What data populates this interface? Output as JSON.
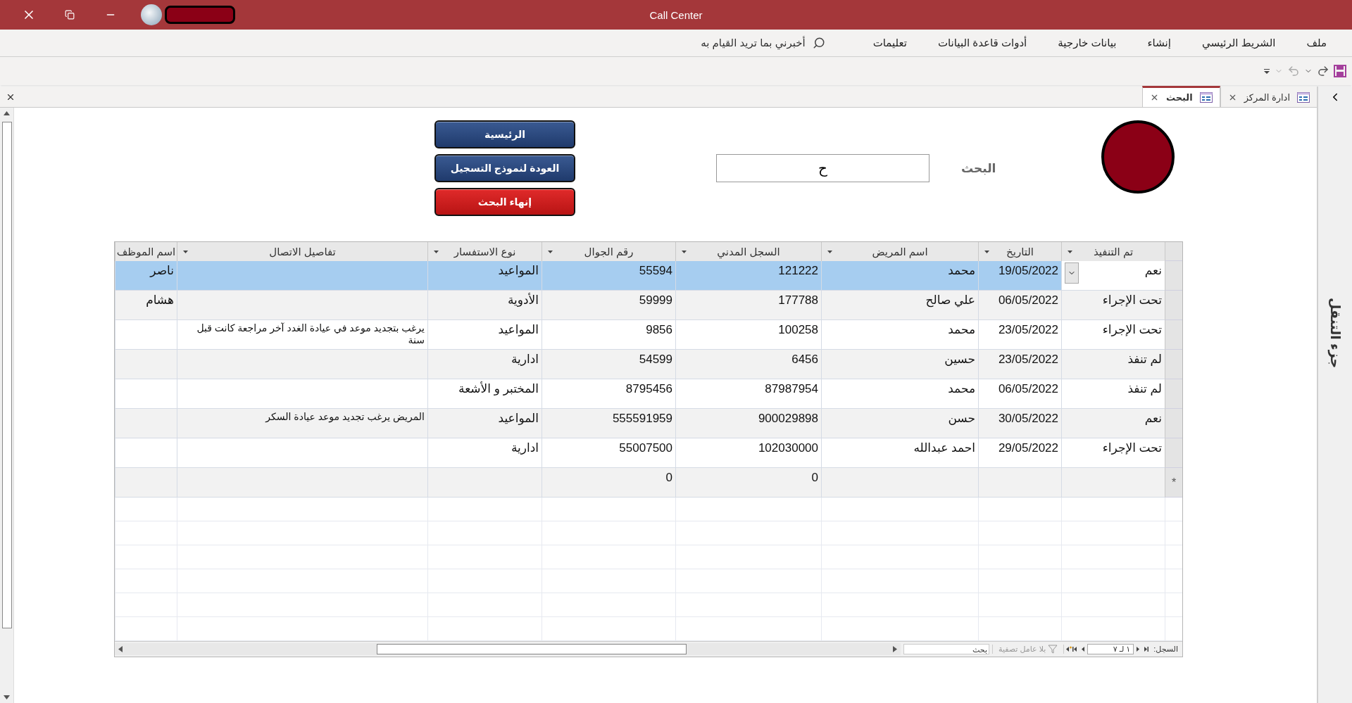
{
  "window": {
    "title": "Call Center"
  },
  "ribbon_tabs": [
    "ملف",
    "الشريط الرئيسي",
    "إنشاء",
    "بيانات خارجية",
    "أدوات قاعدة البيانات",
    "تعليمات"
  ],
  "tell_me": {
    "placeholder": "أخبرني بما تريد القيام به"
  },
  "document_tabs": [
    {
      "label": "ادارة المركز",
      "selected": false
    },
    {
      "label": "البحث",
      "selected": true
    }
  ],
  "form": {
    "search_label": "البحث",
    "search_value": "ح",
    "buttons": [
      {
        "label": "الرئيسية",
        "kind": "primary"
      },
      {
        "label": "العودة لنموذج التسجيل",
        "kind": "primary"
      },
      {
        "label": "إنهاء البحث",
        "kind": "danger"
      }
    ]
  },
  "table": {
    "columns": [
      "تم التنفيذ",
      "التاريخ",
      "اسم المريض",
      "السجل المدني",
      "رقم الجوال",
      "نوع الاستفسار",
      "تفاصيل الاتصال",
      "اسم الموظف"
    ],
    "rows": [
      {
        "selected": true,
        "cells": [
          "نعم",
          "19/05/2022",
          "محمد",
          "121222",
          "55594",
          "المواعيد",
          "",
          "ناصر"
        ]
      },
      {
        "selected": false,
        "cells": [
          "تحت الإجراء",
          "06/05/2022",
          "علي صالح",
          "177788",
          "59999",
          "الأدوية",
          "",
          "هشام"
        ]
      },
      {
        "selected": false,
        "cells": [
          "تحت الإجراء",
          "23/05/2022",
          "محمد",
          "100258",
          "9856",
          "المواعيد",
          "يرغب بتجديد موعد في عيادة الغدد آخر مراجعة كانت قبل سنة",
          ""
        ]
      },
      {
        "selected": false,
        "cells": [
          "لم تنفذ",
          "23/05/2022",
          "حسين",
          "6456",
          "54599",
          "ادارية",
          "",
          ""
        ]
      },
      {
        "selected": false,
        "cells": [
          "لم تنفذ",
          "06/05/2022",
          "محمد",
          "87987954",
          "8795456",
          "المختبر و الأشعة",
          "",
          ""
        ]
      },
      {
        "selected": false,
        "cells": [
          "نعم",
          "30/05/2022",
          "حسن",
          "900029898",
          "555591959",
          "المواعيد",
          "المريض يرغب تجديد موعد عيادة السكر",
          ""
        ]
      },
      {
        "selected": false,
        "cells": [
          "تحت الإجراء",
          "29/05/2022",
          "احمد عبدالله",
          "102030000",
          "55007500",
          "ادارية",
          "",
          ""
        ]
      }
    ],
    "new_row": {
      "marker": "*",
      "cells": [
        "",
        "",
        "",
        "0",
        "0",
        "",
        "",
        ""
      ]
    }
  },
  "record_nav": {
    "label": "السجل:",
    "position": "١ لـ ٧",
    "filter": "بلا عامل تصفية",
    "search": {
      "placeholder": "بحث"
    }
  },
  "navigation_pane": {
    "label": "جزء التنقل"
  }
}
